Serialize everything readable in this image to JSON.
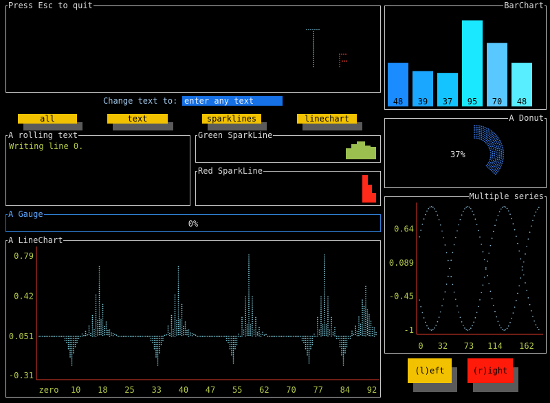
{
  "top_panel": {
    "title": "Press Esc to quit"
  },
  "prompt": {
    "label": "Change text to:",
    "placeholder": "enter any text"
  },
  "buttons": {
    "all": "all",
    "text": "text",
    "sparklines": "sparklines",
    "linechart": "linechart",
    "left": "(l)eft",
    "right": "(r)ight"
  },
  "rolling_text": {
    "title": "A rolling text",
    "line": "Writing line 0."
  },
  "green_sparkline": {
    "title": "Green SparkLine",
    "color": "#9bc050"
  },
  "red_sparkline": {
    "title": "Red SparkLine",
    "color": "#ff2a1a"
  },
  "gauge": {
    "title": "A Gauge",
    "label": "0%",
    "value": 0
  },
  "barchart_panel": {
    "title": "BarChart"
  },
  "donut_panel": {
    "title": "A Donut"
  },
  "linechart_panel": {
    "title": "A LineChart"
  },
  "multi_panel": {
    "title": "Multiple series"
  },
  "chart_data": [
    {
      "type": "bar",
      "title": "BarChart",
      "categories": [
        "",
        "",
        "",
        "",
        "",
        ""
      ],
      "values": [
        48,
        39,
        37,
        95,
        70,
        48
      ],
      "colors": [
        "#1a8cff",
        "#1aa7ff",
        "#13c4ff",
        "#19e8ff",
        "#59c8ff",
        "#58eeff"
      ]
    },
    {
      "type": "pie",
      "title": "A Donut",
      "values": [
        37
      ],
      "label": "37%",
      "color": "#3a78e0"
    },
    {
      "type": "line",
      "title": "A LineChart",
      "x_tick_labels": [
        "zero",
        "10",
        "18",
        "25",
        "33",
        "40",
        "47",
        "55",
        "62",
        "70",
        "77",
        "84",
        "92"
      ],
      "y_tick_labels": [
        "0.79",
        "0.42",
        "0.051",
        "-0.31"
      ],
      "ylim": [
        -0.31,
        0.79
      ],
      "color": "#7fc9d8"
    },
    {
      "type": "line",
      "title": "Multiple series",
      "x_tick_labels": [
        "0",
        "32",
        "73",
        "114",
        "162"
      ],
      "y_tick_labels": [
        "0.64",
        "0.089",
        "-0.45",
        "-1"
      ],
      "ylim": [
        -1,
        1
      ],
      "color": "#8ab6cf"
    }
  ]
}
